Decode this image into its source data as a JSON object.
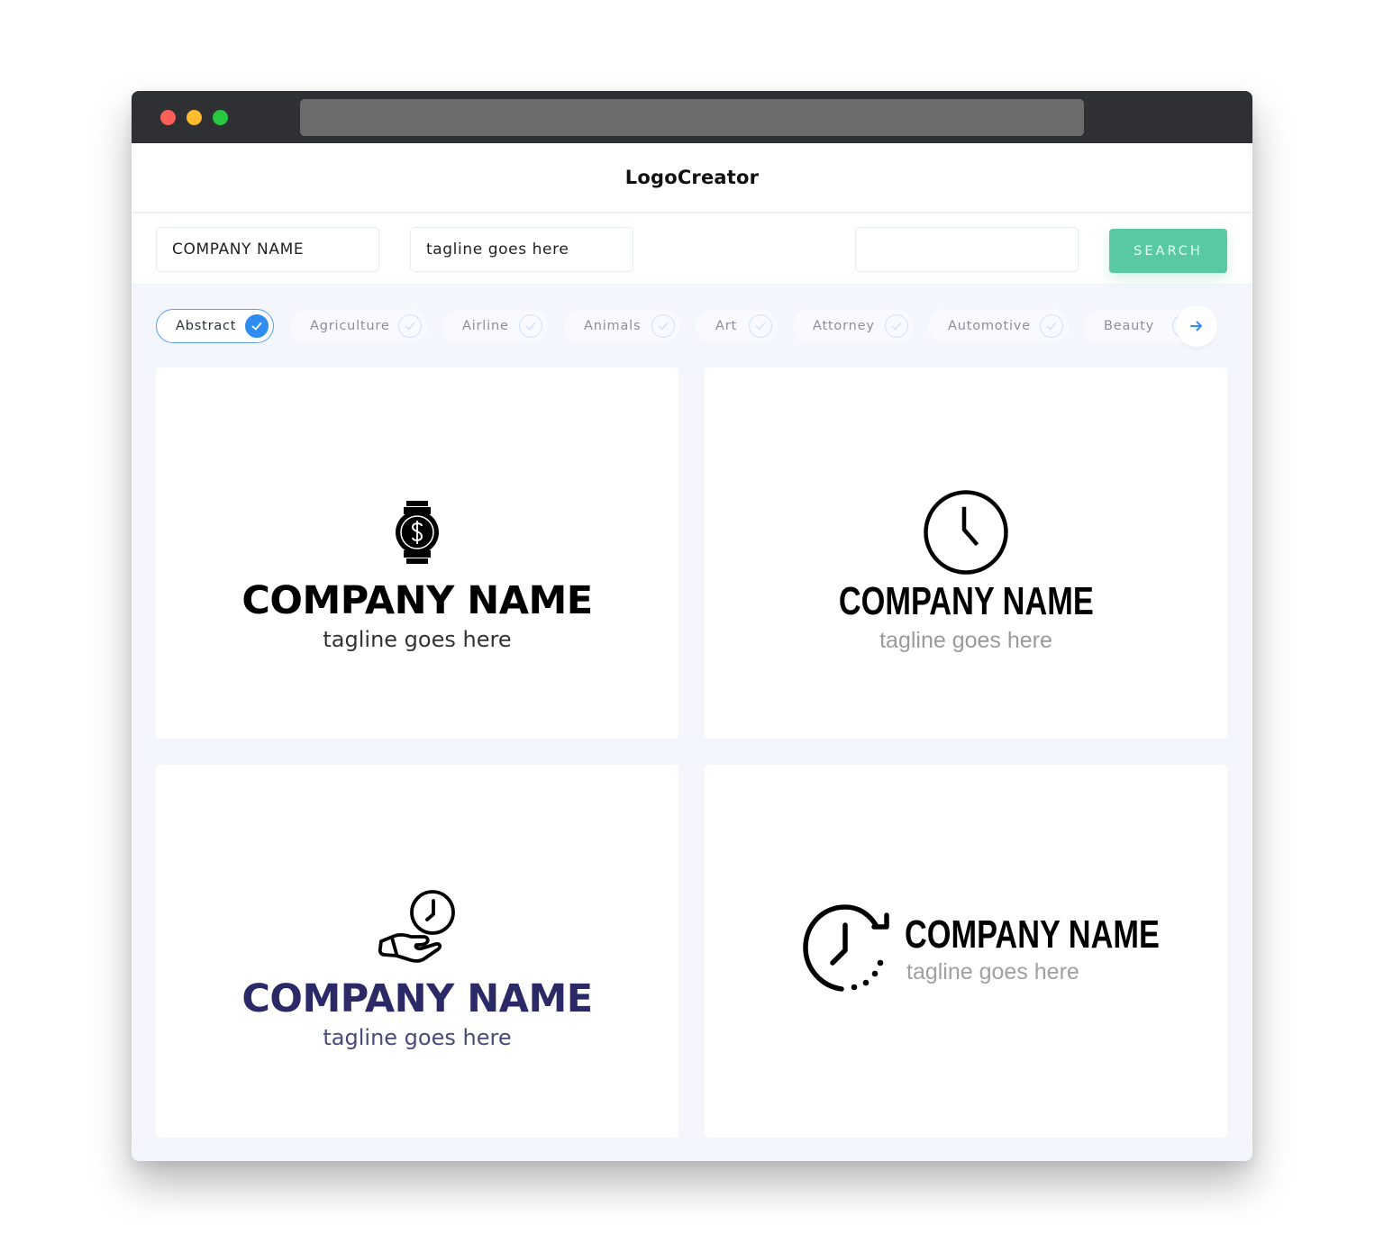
{
  "app": {
    "title": "LogoCreator"
  },
  "window": {
    "traffic_lights": [
      "close",
      "minimize",
      "maximize"
    ]
  },
  "search": {
    "company_name_value": "COMPANY NAME",
    "tagline_value": "tagline goes here",
    "keyword_value": "",
    "search_label": "SEARCH",
    "accent_color": "#58c9a0"
  },
  "categories": {
    "items": [
      {
        "label": "Abstract",
        "selected": true
      },
      {
        "label": "Agriculture",
        "selected": false
      },
      {
        "label": "Airline",
        "selected": false
      },
      {
        "label": "Animals",
        "selected": false
      },
      {
        "label": "Art",
        "selected": false
      },
      {
        "label": "Attorney",
        "selected": false
      },
      {
        "label": "Automotive",
        "selected": false
      },
      {
        "label": "Beauty",
        "selected": false
      }
    ],
    "next_icon": "arrow-right-icon",
    "selected_color": "#2f8cf0"
  },
  "logos": [
    {
      "icon": "dollar-watch-icon",
      "company": "COMPANY NAME",
      "tagline": "tagline goes here",
      "color": "#000000",
      "tagline_color": "#333333"
    },
    {
      "icon": "clock-icon",
      "company": "COMPANY NAME",
      "tagline": "tagline goes here",
      "color": "#000000",
      "tagline_color": "#9a9a9a"
    },
    {
      "icon": "hand-clock-icon",
      "company": "COMPANY NAME",
      "tagline": "tagline goes here",
      "color": "#2b2a66",
      "tagline_color": "#4a4a7a"
    },
    {
      "icon": "clock-refresh-icon",
      "company": "COMPANY NAME",
      "tagline": "tagline goes here",
      "color": "#000000",
      "tagline_color": "#a0a0a0"
    }
  ]
}
